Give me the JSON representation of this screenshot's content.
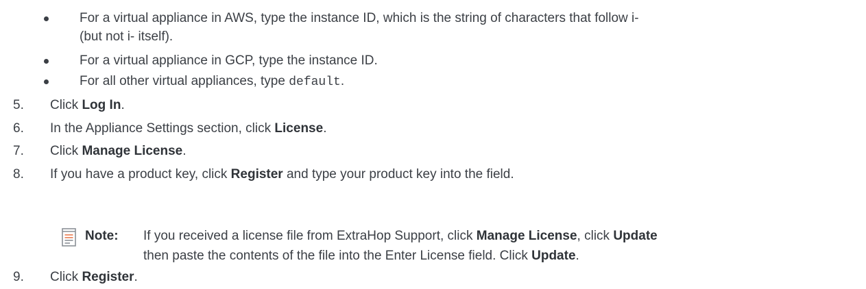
{
  "bullets": [
    {
      "line1": "For a virtual appliance in AWS, type the instance ID, which is the string of characters that follow i-",
      "line2": "(but not i- itself)."
    },
    {
      "text": "For a virtual appliance in GCP, type the instance ID."
    },
    {
      "pre": "For all other virtual appliances, type ",
      "code": "default",
      "post": "."
    }
  ],
  "steps": [
    {
      "num": "5.",
      "pre": "Click ",
      "bold": "Log In",
      "post": "."
    },
    {
      "num": "6.",
      "pre": "In the Appliance Settings section, click ",
      "bold": "License",
      "post": "."
    },
    {
      "num": "7.",
      "pre": "Click ",
      "bold": "Manage License",
      "post": "."
    },
    {
      "num": "8.",
      "pre": "If you have a product key, click ",
      "bold": "Register",
      "post": " and type your product key into the field."
    },
    {
      "num": "9.",
      "pre": "Click ",
      "bold": "Register",
      "post": "."
    }
  ],
  "note": {
    "label": "Note:",
    "line1_pre": "If you received a license file from ExtraHop Support, click ",
    "line1_bold1": "Manage License",
    "line1_mid": ", click ",
    "line1_bold2": "Update",
    "line2_pre": "then paste the contents of the file into the Enter License field. Click ",
    "line2_bold": "Update",
    "line2_post": "."
  },
  "icons": {
    "bullet": "bullet-dot",
    "note": "note-document-icon"
  },
  "colors": {
    "text": "#3b3f45",
    "note_icon_frame": "#8a8f96",
    "note_icon_lines": "#e8784e"
  }
}
